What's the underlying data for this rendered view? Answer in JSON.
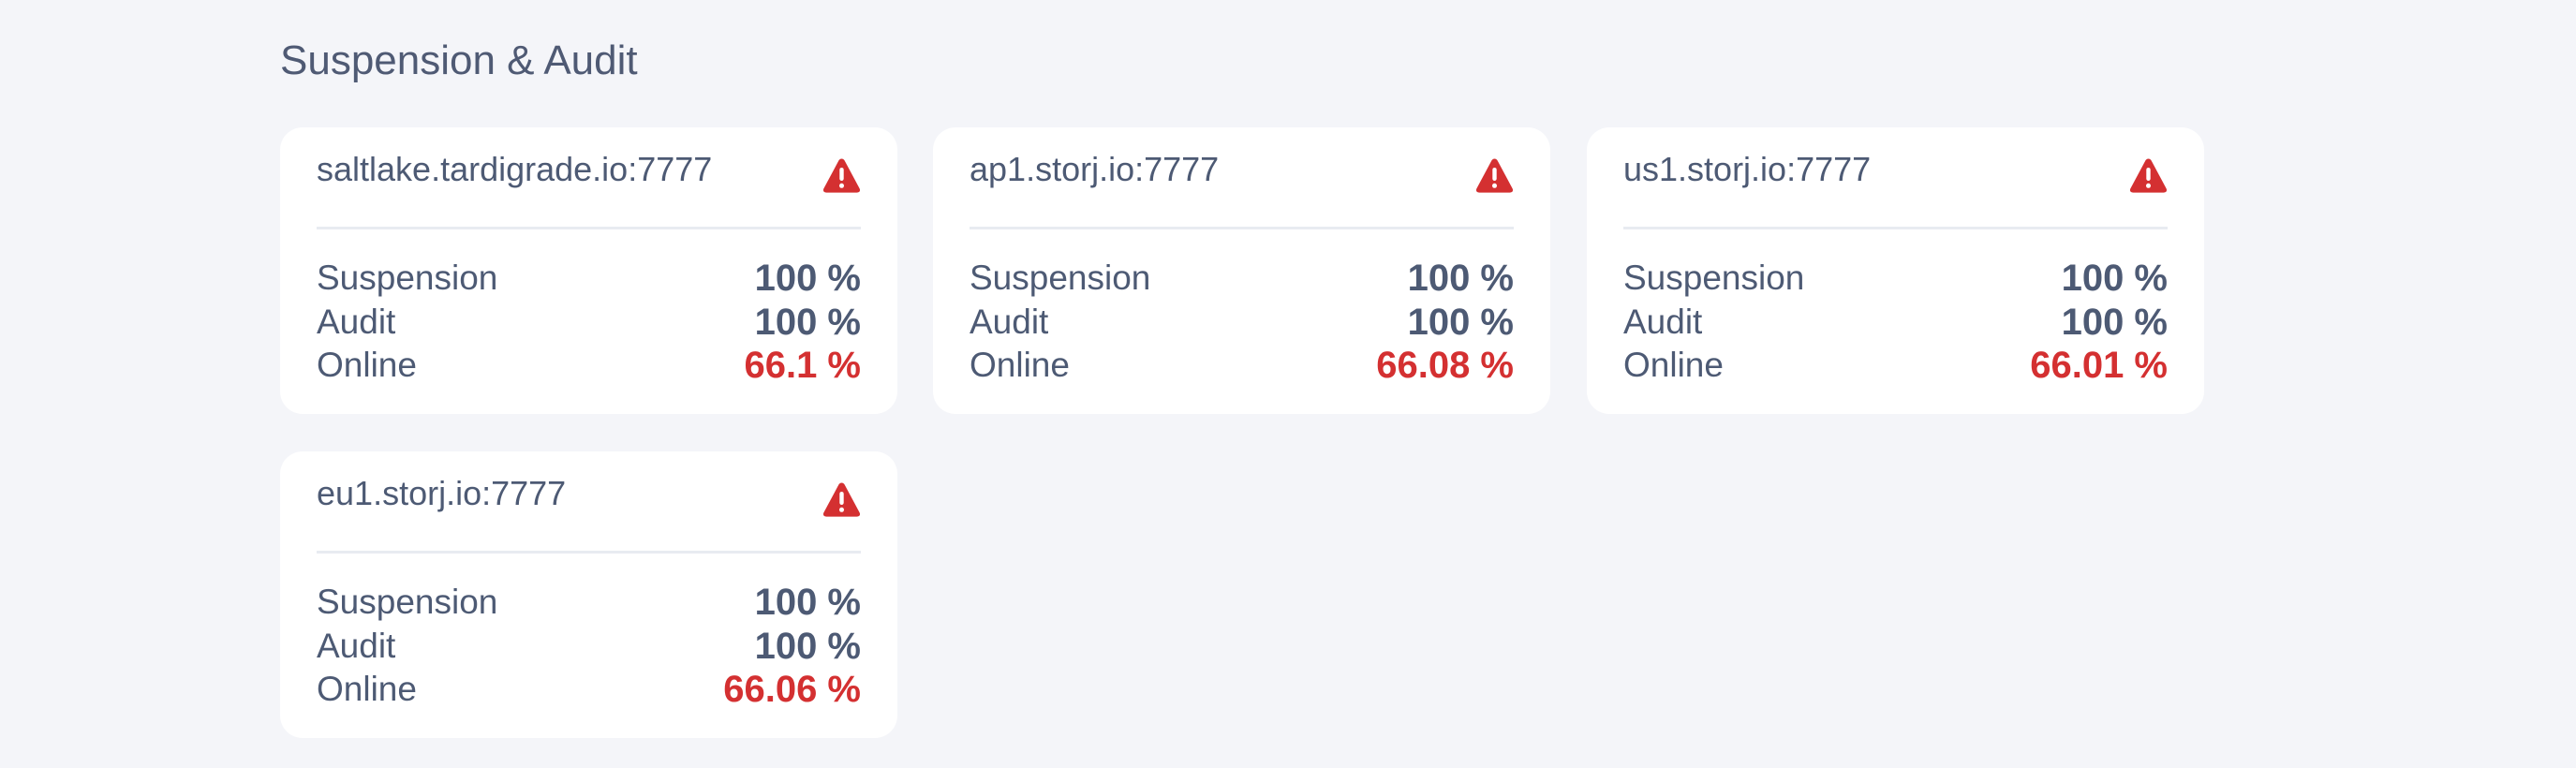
{
  "section": {
    "title": "Suspension & Audit"
  },
  "colors": {
    "background": "#f4f5f9",
    "card": "#ffffff",
    "text": "#4d5a74",
    "danger": "#d43031",
    "divider": "#e8ebf1"
  },
  "satellites": [
    {
      "name": "saltlake.tardigrade.io:7777",
      "status_icon": "warning-icon",
      "suspension_label": "Suspension",
      "suspension_value": "100 %",
      "audit_label": "Audit",
      "audit_value": "100 %",
      "online_label": "Online",
      "online_value": "66.1 %"
    },
    {
      "name": "ap1.storj.io:7777",
      "status_icon": "warning-icon",
      "suspension_label": "Suspension",
      "suspension_value": "100 %",
      "audit_label": "Audit",
      "audit_value": "100 %",
      "online_label": "Online",
      "online_value": "66.08 %"
    },
    {
      "name": "us1.storj.io:7777",
      "status_icon": "warning-icon",
      "suspension_label": "Suspension",
      "suspension_value": "100 %",
      "audit_label": "Audit",
      "audit_value": "100 %",
      "online_label": "Online",
      "online_value": "66.01 %"
    },
    {
      "name": "eu1.storj.io:7777",
      "status_icon": "warning-icon",
      "suspension_label": "Suspension",
      "suspension_value": "100 %",
      "audit_label": "Audit",
      "audit_value": "100 %",
      "online_label": "Online",
      "online_value": "66.06 %"
    }
  ]
}
